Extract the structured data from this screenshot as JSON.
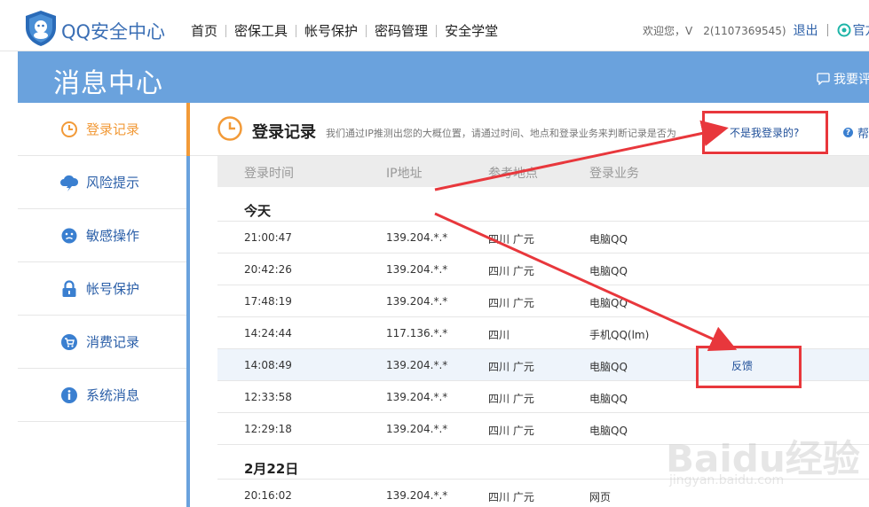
{
  "header": {
    "brand": "QQ安全中心",
    "nav": [
      "首页",
      "密保工具",
      "帐号保护",
      "密码管理",
      "安全学堂"
    ],
    "welcome": "欢迎您，V　2(1107369545)",
    "logout": "退出",
    "official": "官方"
  },
  "banner": {
    "title": "消息中心",
    "feedback_label": "我要评"
  },
  "sidebar": {
    "items": [
      {
        "label": "登录记录",
        "icon": "clock-icon",
        "active": true
      },
      {
        "label": "风险提示",
        "icon": "cloud-lightning-icon",
        "active": false
      },
      {
        "label": "敏感操作",
        "icon": "face-icon",
        "active": false
      },
      {
        "label": "帐号保护",
        "icon": "lock-icon",
        "active": false
      },
      {
        "label": "消费记录",
        "icon": "cart-icon",
        "active": false
      },
      {
        "label": "系统消息",
        "icon": "info-icon",
        "active": false
      }
    ]
  },
  "main": {
    "title": "登录记录",
    "description": "我们通过IP推测出您的大概位置，请通过时间、地点和登录业务来判断记录是否为",
    "not_me_link": "不是我登录的?",
    "help": "帮",
    "columns": [
      "登录时间",
      "IP地址",
      "参考地点",
      "登录业务"
    ],
    "groups": [
      {
        "title": "今天",
        "rows": [
          {
            "time": "21:00:47",
            "ip": "139.204.*.*",
            "location": "四川 广元",
            "service": "电脑QQ",
            "feedback": ""
          },
          {
            "time": "20:42:26",
            "ip": "139.204.*.*",
            "location": "四川 广元",
            "service": "电脑QQ",
            "feedback": ""
          },
          {
            "time": "17:48:19",
            "ip": "139.204.*.*",
            "location": "四川 广元",
            "service": "电脑QQ",
            "feedback": ""
          },
          {
            "time": "14:24:44",
            "ip": "117.136.*.*",
            "location": "四川",
            "service": "手机QQ(lm)",
            "feedback": ""
          },
          {
            "time": "14:08:49",
            "ip": "139.204.*.*",
            "location": "四川 广元",
            "service": "电脑QQ",
            "feedback": "反馈"
          },
          {
            "time": "12:33:58",
            "ip": "139.204.*.*",
            "location": "四川 广元",
            "service": "电脑QQ",
            "feedback": ""
          },
          {
            "time": "12:29:18",
            "ip": "139.204.*.*",
            "location": "四川 广元",
            "service": "电脑QQ",
            "feedback": ""
          }
        ]
      },
      {
        "title": "2月22日",
        "rows": [
          {
            "time": "20:16:02",
            "ip": "139.204.*.*",
            "location": "四川 广元",
            "service": "网页",
            "feedback": ""
          }
        ]
      }
    ]
  },
  "colors": {
    "banner_blue": "#6aa2dd",
    "link_blue": "#2b5fa8",
    "active_orange": "#f29a38",
    "annotation_red": "#e8373c"
  },
  "watermark": {
    "text": "Baidu经验",
    "sub": "jingyan.baidu.com"
  }
}
